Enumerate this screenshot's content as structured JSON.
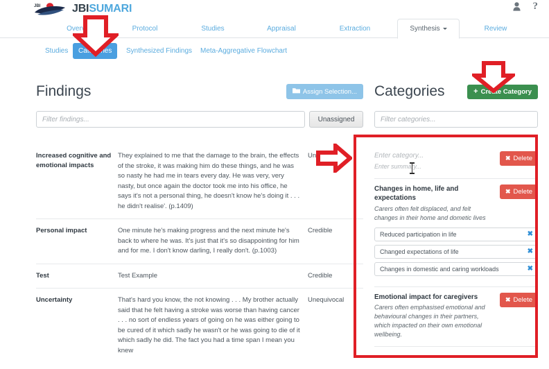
{
  "brand": {
    "logo_icon": "jbi-swoosh-logo",
    "name_bold": "JBI",
    "name_light": "SUMARI"
  },
  "topbar": {
    "user_icon": "user-icon",
    "help_icon": "question-mark-icon"
  },
  "main_nav": {
    "items": [
      {
        "label": "Overview",
        "active": false
      },
      {
        "label": "Protocol",
        "active": false
      },
      {
        "label": "Studies",
        "active": false
      },
      {
        "label": "Appraisal",
        "active": false
      },
      {
        "label": "Extraction",
        "active": false
      },
      {
        "label": "Synthesis",
        "active": true
      },
      {
        "label": "Review",
        "active": false
      }
    ]
  },
  "sub_nav": {
    "items": [
      {
        "label": "Studies",
        "active": false
      },
      {
        "label": "Categories",
        "active": true
      },
      {
        "label": "Synthesized Findings",
        "active": false
      },
      {
        "label": "Meta-Aggregative Flowchart",
        "active": false
      }
    ]
  },
  "findings_panel": {
    "title": "Findings",
    "assign_button": "Assign Selection...",
    "assign_icon": "folder-icon",
    "filter_placeholder": "Filter findings...",
    "filter_value": "",
    "unassigned_button": "Unassigned",
    "rows": [
      {
        "name": "Increased cognitive and emotional impacts",
        "text": "They explained to me that the damage to the brain, the effects of the stroke, it was making him do these things, and he was so nasty he had me in tears every day. He was very, very nasty, but once again the doctor took me into his office, he says it's not a personal thing, he doesn't know he's doing it . . . he didn't realise'. (p.1409)",
        "level": "Unequivocal"
      },
      {
        "name": "Personal impact",
        "text": "One minute he's making progress and the next minute he's back to where he was. It's just that it's so disappointing for him and for me. I don't know darling, I really don't. (p.1003)",
        "level": "Credible"
      },
      {
        "name": "Test",
        "text": "Test Example",
        "level": "Credible"
      },
      {
        "name": "Uncertainty",
        "text": "That's hard you know, the not knowing . . . My brother actually said that he felt having a stroke was worse than having cancer . . . no sort of endless years of going on he was either going to be cured of it which sadly he wasn't or he was going to die of it which sadly he did. The fact you had a time span I mean you knew",
        "level": "Unequivocal"
      }
    ]
  },
  "categories_panel": {
    "title": "Categories",
    "create_button": "Create Category",
    "create_icon": "plus-icon",
    "filter_placeholder": "Filter categories...",
    "filter_value": "",
    "delete_label": "Delete",
    "delete_icon": "x-icon",
    "remove_icon": "x-icon",
    "categories": [
      {
        "title": "",
        "title_placeholder": "Enter category...",
        "summary": "",
        "summary_placeholder": "Enter summary...",
        "is_new": true,
        "findings": []
      },
      {
        "title": "Changes in home, life and expectations",
        "summary": "Carers often felt displaced, and felt changes in their home and dometic lives",
        "is_new": false,
        "findings": [
          "Reduced participation in life",
          "Changed expectations of life",
          "Changes in domestic and caring workloads"
        ]
      },
      {
        "title": "Emotional impact for caregivers",
        "summary": "Carers often emphasised emotional and behavioural changes in their partners, which impacted on their own emotional wellbeing.",
        "is_new": false,
        "findings": []
      }
    ]
  },
  "annotations": {
    "color": "#e01f26",
    "markers": [
      {
        "name": "arrow-down-to-categories-tab",
        "shape": "arrow-down"
      },
      {
        "name": "arrow-down-to-create-category",
        "shape": "arrow-down"
      },
      {
        "name": "arrow-right-to-categories-panel",
        "shape": "arrow-right"
      },
      {
        "name": "highlight-box-categories-panel",
        "shape": "rectangle"
      }
    ]
  }
}
